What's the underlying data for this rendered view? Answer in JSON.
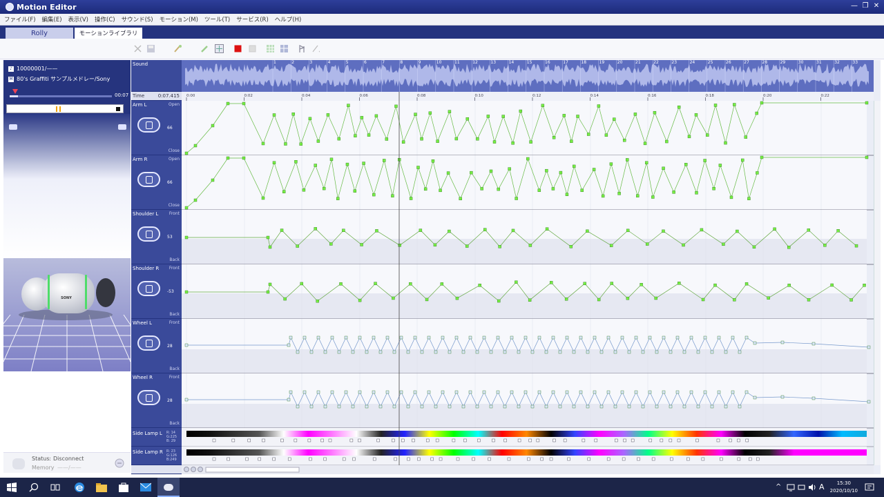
{
  "window": {
    "title": "Motion Editor",
    "controls": [
      "—",
      "❐",
      "✕"
    ]
  },
  "menu": [
    "ファイル(F)",
    "編集(E)",
    "表示(V)",
    "操作(C)",
    "サウンド(S)",
    "モーション(M)",
    "ツール(T)",
    "サービス(R)",
    "ヘルプ(H)"
  ],
  "tabs": {
    "rolly": "Rolly",
    "library": "モーションライブラリ"
  },
  "player": {
    "track_id": "10000001/——",
    "song": "80's Graffiti サンプルメドレー/Sony",
    "time": "00:07",
    "progress": 0.08
  },
  "preview": {
    "robot_label": "SONY"
  },
  "status": {
    "label": "Status",
    "separator": ":",
    "value": "Disconnect",
    "memory_label": "Memory",
    "memory_value": "——/——"
  },
  "timeline": {
    "sound_label": "Sound",
    "time_label": "Time",
    "time_value": "0:07.415",
    "bar_numbers": [
      "1",
      "2",
      "3",
      "4",
      "5",
      "6",
      "7",
      "8",
      "9",
      "10",
      "11",
      "12",
      "13",
      "14",
      "15",
      "16",
      "17",
      "18",
      "19",
      "20",
      "21",
      "22",
      "23",
      "24",
      "25",
      "26",
      "27",
      "28",
      "29",
      "30",
      "31",
      "32",
      "33"
    ],
    "time_ticks": [
      "0:00",
      "0:02",
      "0:04",
      "0:06",
      "0:08",
      "0:10",
      "0:12",
      "0:14",
      "0:16",
      "0:18",
      "0:20",
      "0:22"
    ],
    "tracks": [
      {
        "name": "Arm L",
        "top": "Open",
        "bottom": "Close",
        "value": "66"
      },
      {
        "name": "Arm R",
        "top": "Open",
        "bottom": "Close",
        "value": "66"
      },
      {
        "name": "Shoulder L",
        "top": "Front",
        "bottom": "Back",
        "value": "53"
      },
      {
        "name": "Shoulder R",
        "top": "Front",
        "bottom": "Back",
        "value": "-53"
      },
      {
        "name": "Wheel L",
        "top": "Front",
        "bottom": "Back",
        "value": "28"
      },
      {
        "name": "Wheel R",
        "top": "Front",
        "bottom": "Back",
        "value": "28"
      }
    ],
    "lamps": [
      {
        "name": "Side Lamp L",
        "rgb": [
          "R: 14",
          "G:225",
          "B: 29"
        ]
      },
      {
        "name": "Side Lamp R",
        "rgb": [
          "R: 23",
          "G:126",
          "B:249"
        ]
      }
    ]
  },
  "taskbar": {
    "time": "15:30",
    "date": "2020/10/10",
    "ime": "A"
  },
  "colors": {
    "keyframe": "#66ee33",
    "curve": "#44aa22",
    "wheel_key": "#4477dd",
    "panel": "#3a4a9a"
  }
}
